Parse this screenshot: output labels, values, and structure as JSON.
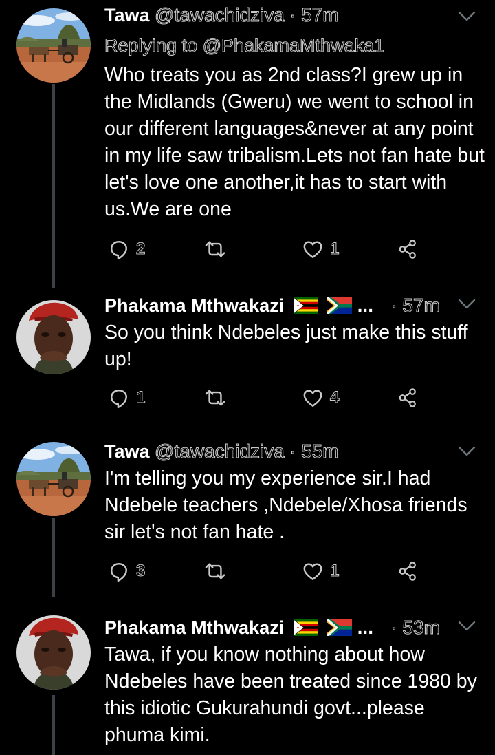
{
  "colors": {
    "background": "#000000",
    "text_primary": "#ffffff",
    "text_secondary": "#c9c9c9",
    "thread_line": "#3d4147"
  },
  "tweets": [
    {
      "name": "Tawa",
      "handle": "@tawachidziva",
      "separator": "·",
      "time": "57m",
      "reply_to": "Replying to @PhakamaMthwaka1",
      "text": "Who treats you as 2nd class?I grew up in the Midlands (Gweru)  we went to school in our different languages&never at any point in my life saw tribalism.Lets not fan hate but let's love one another,it has to start with us.We are one",
      "replies": "2",
      "likes": "1",
      "avatar": "scotch-cart-photo",
      "icons": [
        "reply-icon",
        "retweet-icon",
        "like-icon",
        "share-icon",
        "caret-down-icon"
      ]
    },
    {
      "name": "Phakama Mthwakazi",
      "flags": [
        "zimbabwe-flag",
        "south-africa-flag"
      ],
      "ellipsis": "...",
      "separator": "·",
      "time": "57m",
      "text": "So you think Ndebeles just make this stuff up!",
      "replies": "1",
      "likes": "4",
      "avatar": "man-red-beret-portrait"
    },
    {
      "name": "Tawa",
      "handle": "@tawachidziva",
      "separator": "·",
      "time": "55m",
      "text": "I'm telling you my experience sir.I had Ndebele teachers ,Ndebele/Xhosa friends sir let's not fan hate .",
      "replies": "3",
      "likes": "1",
      "avatar": "scotch-cart-photo"
    },
    {
      "name": "Phakama Mthwakazi",
      "flags": [
        "zimbabwe-flag",
        "south-africa-flag"
      ],
      "ellipsis": "...",
      "separator": "·",
      "time": "53m",
      "text": "Tawa, if you know nothing about how Ndebeles have been treated since 1980 by this idiotic Gukurahundi govt...please phuma kimi.",
      "avatar": "man-red-beret-portrait"
    }
  ]
}
